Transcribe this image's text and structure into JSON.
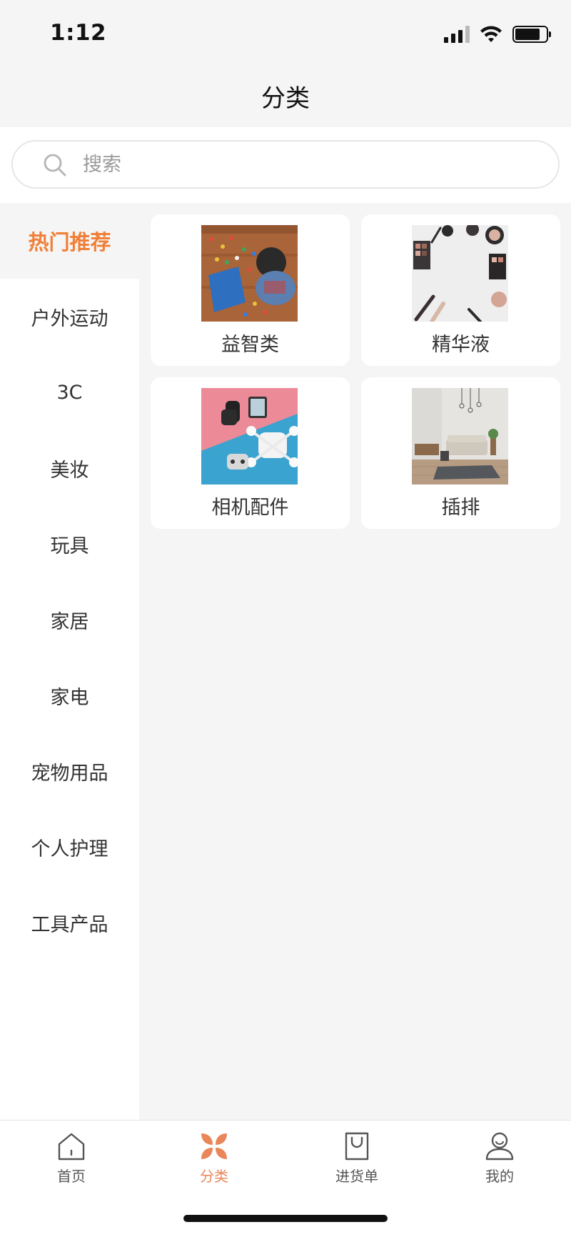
{
  "status_bar": {
    "time": "1:12"
  },
  "nav": {
    "title": "分类"
  },
  "search": {
    "placeholder": "搜索"
  },
  "sidebar": {
    "items": [
      {
        "label": "热门推荐",
        "active": true
      },
      {
        "label": "户外运动",
        "active": false
      },
      {
        "label": "3C",
        "active": false
      },
      {
        "label": "美妆",
        "active": false
      },
      {
        "label": "玩具",
        "active": false
      },
      {
        "label": "家居",
        "active": false
      },
      {
        "label": "家电",
        "active": false
      },
      {
        "label": "宠物用品",
        "active": false
      },
      {
        "label": "个人护理",
        "active": false
      },
      {
        "label": "工具产品",
        "active": false
      }
    ]
  },
  "categories": [
    {
      "label": "益智类",
      "image": "toy-blocks-photo"
    },
    {
      "label": "精华液",
      "image": "makeup-photo"
    },
    {
      "label": "相机配件",
      "image": "camera-drone-photo"
    },
    {
      "label": "插排",
      "image": "living-room-photo"
    }
  ],
  "tabbar": {
    "tabs": [
      {
        "label": "首页",
        "icon": "home-icon",
        "active": false
      },
      {
        "label": "分类",
        "icon": "category-icon",
        "active": true
      },
      {
        "label": "进货单",
        "icon": "shopping-bag-icon",
        "active": false
      },
      {
        "label": "我的",
        "icon": "user-icon",
        "active": false
      }
    ]
  },
  "colors": {
    "accent": "#f08038",
    "background": "#f5f5f5",
    "card": "#ffffff"
  }
}
